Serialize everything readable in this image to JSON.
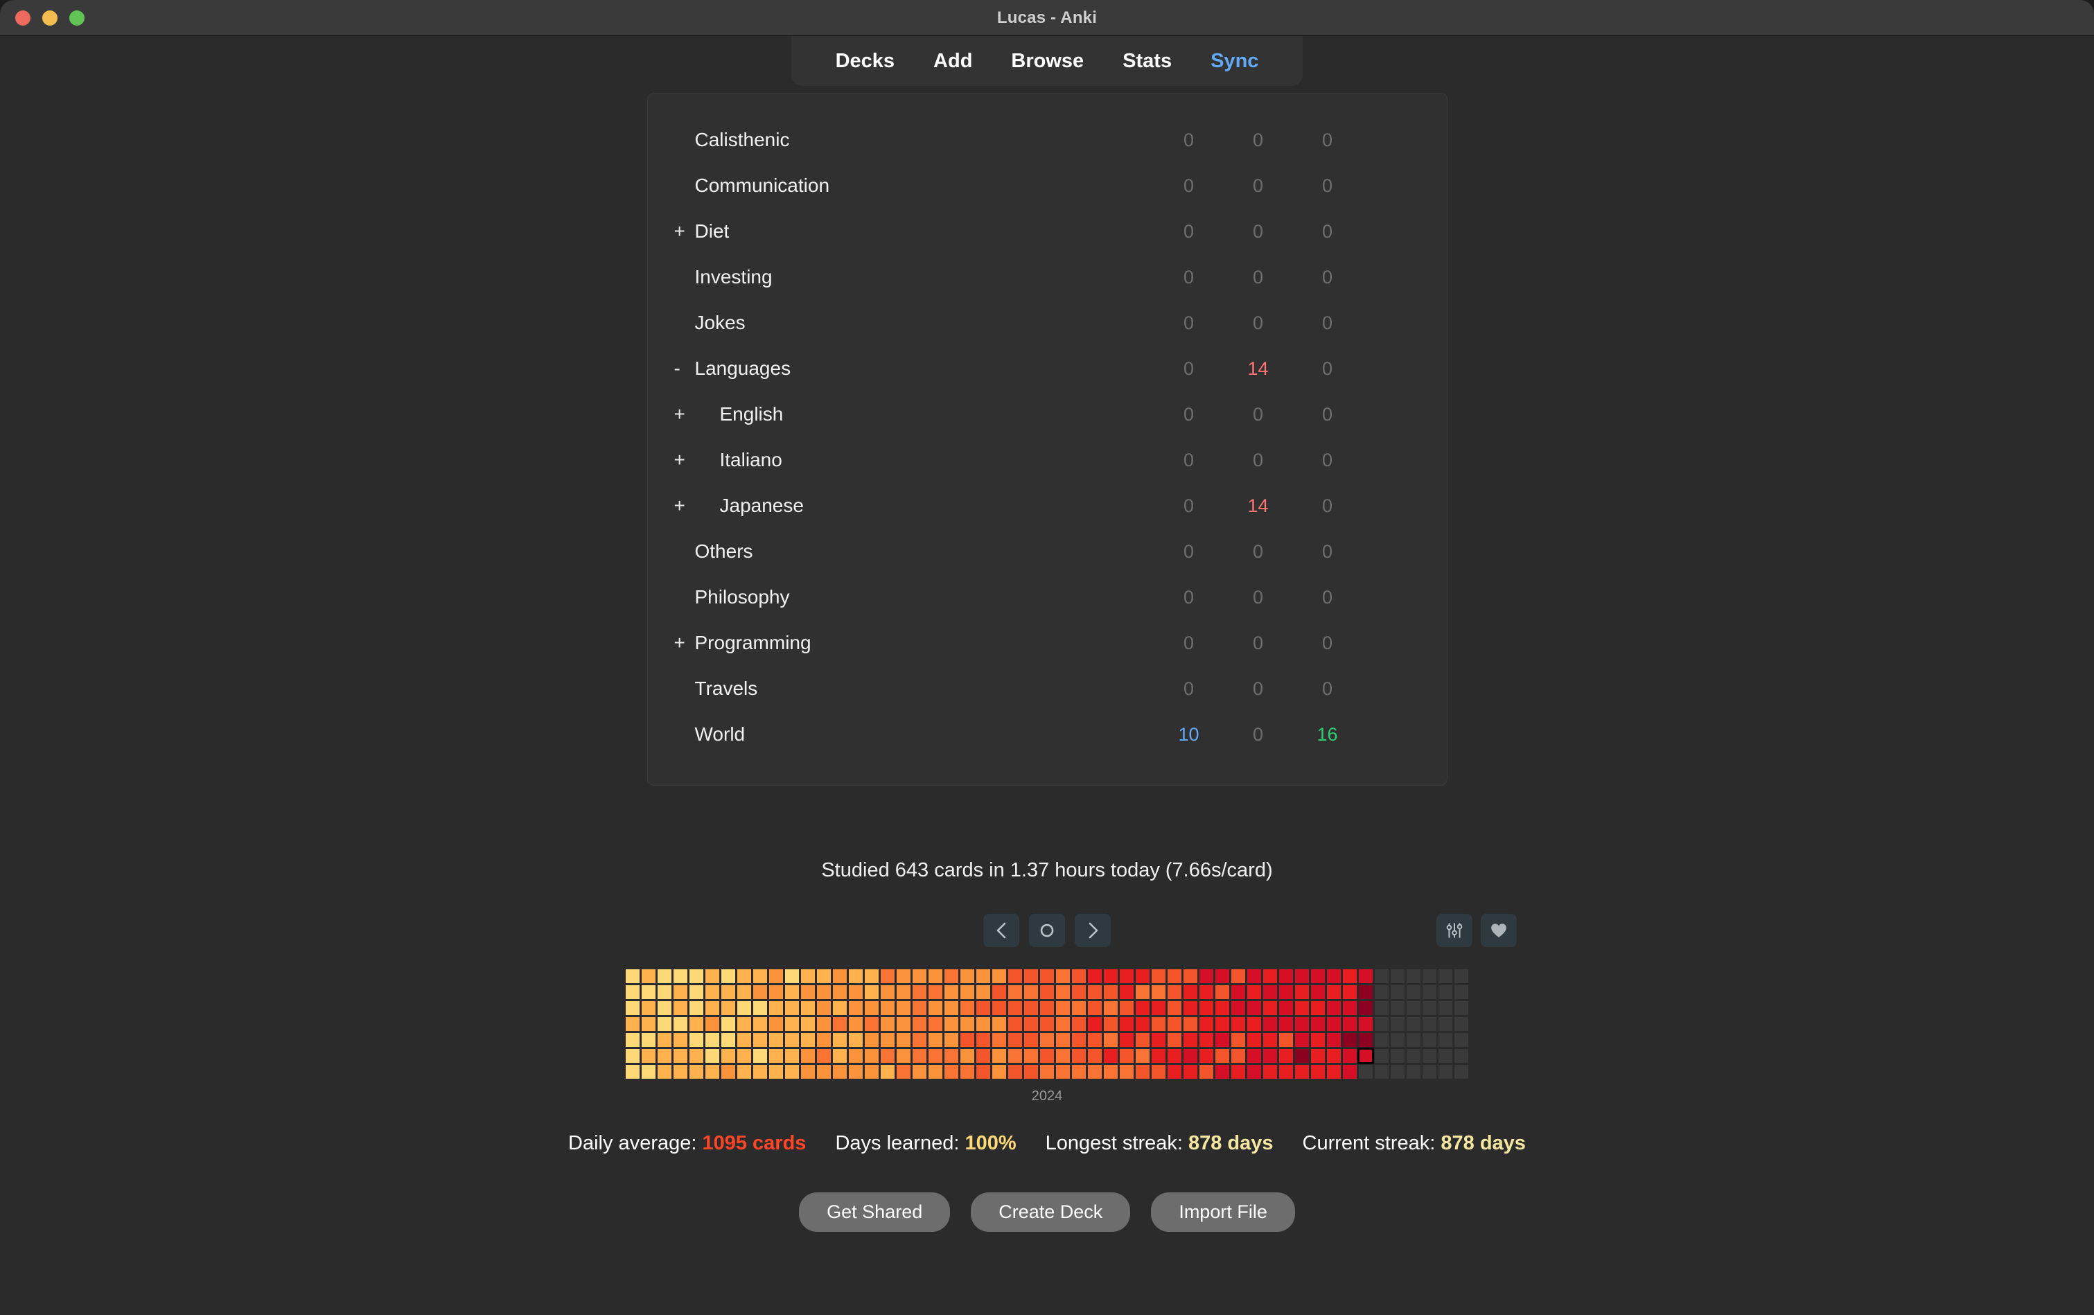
{
  "window": {
    "title": "Lucas - Anki",
    "traffic_lights": [
      "close-button",
      "minimize-button",
      "zoom-button"
    ]
  },
  "nav": {
    "items": [
      {
        "label": "Decks",
        "active": false
      },
      {
        "label": "Add",
        "active": false
      },
      {
        "label": "Browse",
        "active": false
      },
      {
        "label": "Stats",
        "active": false
      },
      {
        "label": "Sync",
        "active": true
      }
    ]
  },
  "decks": {
    "rows": [
      {
        "collapse": "",
        "name": "Calisthenic",
        "indent": 1,
        "new": "0",
        "learn": "0",
        "due": "0",
        "new_class": "zero",
        "learn_class": "zero",
        "due_class": "zero"
      },
      {
        "collapse": "",
        "name": "Communication",
        "indent": 1,
        "new": "0",
        "learn": "0",
        "due": "0",
        "new_class": "zero",
        "learn_class": "zero",
        "due_class": "zero"
      },
      {
        "collapse": "+",
        "name": "Diet",
        "indent": 0,
        "new": "0",
        "learn": "0",
        "due": "0",
        "new_class": "zero",
        "learn_class": "zero",
        "due_class": "zero"
      },
      {
        "collapse": "",
        "name": "Investing",
        "indent": 1,
        "new": "0",
        "learn": "0",
        "due": "0",
        "new_class": "zero",
        "learn_class": "zero",
        "due_class": "zero"
      },
      {
        "collapse": "",
        "name": "Jokes",
        "indent": 1,
        "new": "0",
        "learn": "0",
        "due": "0",
        "new_class": "zero",
        "learn_class": "zero",
        "due_class": "zero"
      },
      {
        "collapse": "-",
        "name": "Languages",
        "indent": 1,
        "new": "0",
        "learn": "14",
        "due": "0",
        "new_class": "zero",
        "learn_class": "due",
        "due_class": "zero"
      },
      {
        "collapse": "+",
        "name": "English",
        "indent": 2,
        "new": "0",
        "learn": "0",
        "due": "0",
        "new_class": "zero",
        "learn_class": "zero",
        "due_class": "zero"
      },
      {
        "collapse": "+",
        "name": "Italiano",
        "indent": 2,
        "new": "0",
        "learn": "0",
        "due": "0",
        "new_class": "zero",
        "learn_class": "zero",
        "due_class": "zero"
      },
      {
        "collapse": "+",
        "name": "Japanese",
        "indent": 2,
        "new": "0",
        "learn": "14",
        "due": "0",
        "new_class": "zero",
        "learn_class": "due",
        "due_class": "zero"
      },
      {
        "collapse": "",
        "name": "Others",
        "indent": 1,
        "new": "0",
        "learn": "0",
        "due": "0",
        "new_class": "zero",
        "learn_class": "zero",
        "due_class": "zero"
      },
      {
        "collapse": "",
        "name": "Philosophy",
        "indent": 1,
        "new": "0",
        "learn": "0",
        "due": "0",
        "new_class": "zero",
        "learn_class": "zero",
        "due_class": "zero"
      },
      {
        "collapse": "+",
        "name": "Programming",
        "indent": 0,
        "new": "0",
        "learn": "0",
        "due": "0",
        "new_class": "zero",
        "learn_class": "zero",
        "due_class": "zero"
      },
      {
        "collapse": "",
        "name": "Travels",
        "indent": 1,
        "new": "0",
        "learn": "0",
        "due": "0",
        "new_class": "zero",
        "learn_class": "zero",
        "due_class": "zero"
      },
      {
        "collapse": "",
        "name": "World",
        "indent": 1,
        "new": "10",
        "learn": "0",
        "due": "16",
        "new_class": "new",
        "learn_class": "zero",
        "due_class": "rev"
      }
    ]
  },
  "summary": {
    "studied_text": "Studied 643 cards in 1.37 hours today (7.66s/card)",
    "cards_studied": 643,
    "hours": 1.37,
    "seconds_per_card": 7.66
  },
  "heatmap_controls": {
    "prev_icon": "chevron-left-icon",
    "today_icon": "circle-icon",
    "next_icon": "chevron-right-icon",
    "settings_icon": "sliders-icon",
    "favorite_icon": "heart-icon"
  },
  "heatmap": {
    "year_label": "2024",
    "rows": 7,
    "columns": 53,
    "colors": {
      "empty": "#3a3a3a",
      "level1": "#ffd977",
      "level2": "#ffb24d",
      "level3": "#fb923c",
      "level4": "#f97335",
      "level5": "#f4552b",
      "level6": "#e81e20",
      "level7": "#d40f26",
      "level8": "#8c0020"
    },
    "today_cell": {
      "column": 47,
      "row": 5
    }
  },
  "stats": {
    "daily_average_label": "Daily average:",
    "daily_average_value": "1095 cards",
    "days_learned_label": "Days learned:",
    "days_learned_value": "100%",
    "longest_streak_label": "Longest streak:",
    "longest_streak_value": "878 days",
    "current_streak_label": "Current streak:",
    "current_streak_value": "878 days"
  },
  "footer_buttons": [
    {
      "label": "Get Shared"
    },
    {
      "label": "Create Deck"
    },
    {
      "label": "Import File"
    }
  ]
}
